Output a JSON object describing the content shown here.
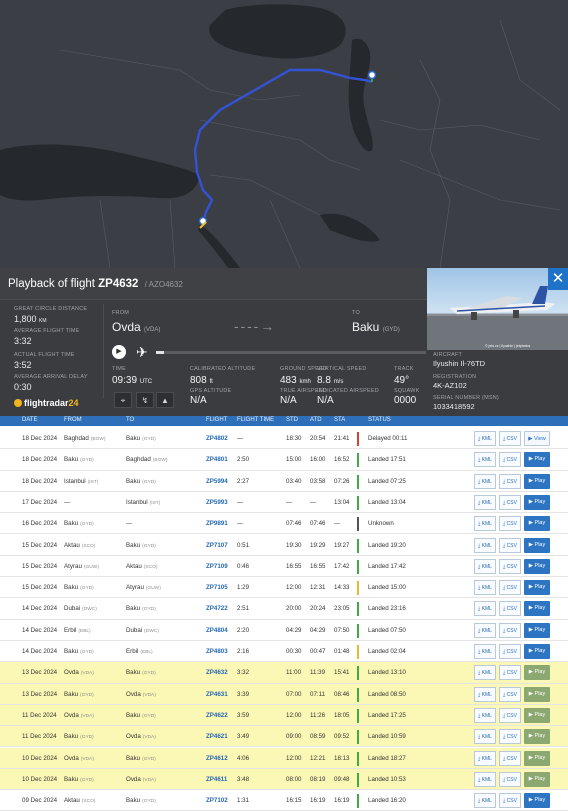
{
  "colors": {
    "route": "#3452d6",
    "panel": "#3a3c40",
    "accent": "#1e73c8",
    "landed": "#40a94a",
    "delayed": "#d9403b",
    "unknown": "#555555",
    "late": "#f2b52f",
    "highlight": "#fbf7b5"
  },
  "panel": {
    "title_prefix": "Playback of flight",
    "flight": "ZP4632",
    "sub": "/ AZO4632",
    "close": "✕",
    "left_stats": [
      {
        "label": "GREAT CIRCLE DISTANCE",
        "value": "1,800",
        "unit": "KM"
      },
      {
        "label": "AVERAGE FLIGHT TIME",
        "value": "3:32"
      },
      {
        "label": "ACTUAL FLIGHT TIME",
        "value": "3:52"
      },
      {
        "label": "AVERAGE ARRIVAL DELAY",
        "value": "0:30"
      }
    ],
    "from_label": "FROM",
    "from_city": "Ovda",
    "from_code": "(VDA)",
    "to_label": "TO",
    "to_city": "Baku",
    "to_code": "(GYD)",
    "arrow": "→",
    "time_label": "TIME",
    "time_value": "09:39",
    "time_unit": "UTC",
    "cal_alt_label": "CALIBRATED ALTITUDE",
    "cal_alt_value": "808",
    "cal_alt_unit": "ft",
    "gps_alt_label": "GPS ALTITUDE",
    "gps_alt_value": "N/A",
    "ground_speed_label": "GROUND SPEED",
    "ground_speed_value": "483",
    "ground_speed_unit": "kmh",
    "true_airspeed_label": "TRUE AIRSPEED",
    "true_airspeed_value": "N/A",
    "vert_speed_label": "VERTICAL SPEED",
    "vert_speed_value": "8.8",
    "vert_speed_unit": "m/s",
    "ind_airspeed_label": "INDICATED AIRSPEED",
    "ind_airspeed_value": "N/A",
    "track_label": "TRACK",
    "track_value": "49°",
    "squawk_label": "SQUAWK",
    "squawk_value": "0000",
    "logo_text": "flightradar",
    "logo_num": "24",
    "photo_credit": "© jets.cz | Ilyushin | jetphotos",
    "aircraft_label": "AIRCRAFT",
    "aircraft_value": "Ilyushin Il-76TD",
    "registration_label": "REGISTRATION",
    "registration_value": "4K-AZ102",
    "serial_label": "SERIAL NUMBER (MSN)",
    "serial_value": "1033418592"
  },
  "table": {
    "headers": [
      "DATE",
      "FROM",
      "TO",
      "FLIGHT",
      "FLIGHT TIME",
      "STD",
      "ATD",
      "STA",
      "STATUS"
    ],
    "kml": "KML",
    "csv": "CSV",
    "play": "▶ Play",
    "view": "▶ View",
    "rows": [
      {
        "date": "18 Dec 2024",
        "from": "Baghdad",
        "from_code": "(BGW)",
        "to": "Baku",
        "to_code": "(GYD)",
        "flight": "ZP4802",
        "ftime": "—",
        "std": "18:30",
        "atd": "20:54",
        "sta": "21:41",
        "status": "Delayed 00:11",
        "bar": "#d9403b",
        "hl": false,
        "btn": "view"
      },
      {
        "date": "18 Dec 2024",
        "from": "Baku",
        "from_code": "(GYD)",
        "to": "Baghdad",
        "to_code": "(BGW)",
        "flight": "ZP4801",
        "ftime": "2:50",
        "std": "15:00",
        "atd": "16:00",
        "sta": "16:52",
        "status": "Landed 17:51",
        "bar": "#40a94a",
        "hl": false,
        "btn": "play"
      },
      {
        "date": "18 Dec 2024",
        "from": "Istanbul",
        "from_code": "(IST)",
        "to": "Baku",
        "to_code": "(GYD)",
        "flight": "ZP5994",
        "ftime": "2:27",
        "std": "03:40",
        "atd": "03:58",
        "sta": "07:26",
        "status": "Landed 07:25",
        "bar": "#40a94a",
        "hl": false,
        "btn": "play"
      },
      {
        "date": "17 Dec 2024",
        "from": "—",
        "from_code": "",
        "to": "Istanbul",
        "to_code": "(IST)",
        "flight": "ZP5993",
        "ftime": "—",
        "std": "—",
        "atd": "—",
        "sta": "13:04",
        "status": "Landed 13:04",
        "bar": "#40a94a",
        "hl": false,
        "btn": "play"
      },
      {
        "date": "16 Dec 2024",
        "from": "Baku",
        "from_code": "(GYD)",
        "to": "—",
        "to_code": "",
        "flight": "ZP9891",
        "ftime": "—",
        "std": "07:46",
        "atd": "07:46",
        "sta": "—",
        "status": "Unknown",
        "bar": "#555555",
        "hl": false,
        "btn": "play"
      },
      {
        "date": "15 Dec 2024",
        "from": "Aktau",
        "from_code": "(SCO)",
        "to": "Baku",
        "to_code": "(GYD)",
        "flight": "ZP7107",
        "ftime": "0:51",
        "std": "19:30",
        "atd": "19:29",
        "sta": "19:27",
        "status": "Landed 19:20",
        "bar": "#40a94a",
        "hl": false,
        "btn": "play"
      },
      {
        "date": "15 Dec 2024",
        "from": "Atyrau",
        "from_code": "(GUW)",
        "to": "Aktau",
        "to_code": "(SCO)",
        "flight": "ZP7109",
        "ftime": "0:46",
        "std": "16:55",
        "atd": "16:55",
        "sta": "17:42",
        "status": "Landed 17:42",
        "bar": "#40a94a",
        "hl": false,
        "btn": "play"
      },
      {
        "date": "15 Dec 2024",
        "from": "Baku",
        "from_code": "(GYD)",
        "to": "Atyrau",
        "to_code": "(GUW)",
        "flight": "ZP7105",
        "ftime": "1:29",
        "std": "12:00",
        "atd": "12:31",
        "sta": "14:33",
        "status": "Landed 15:00",
        "bar": "#f2b52f",
        "hl": false,
        "btn": "play"
      },
      {
        "date": "14 Dec 2024",
        "from": "Dubai",
        "from_code": "(DWC)",
        "to": "Baku",
        "to_code": "(GYD)",
        "flight": "ZP4722",
        "ftime": "2:51",
        "std": "20:00",
        "atd": "20:24",
        "sta": "23:05",
        "status": "Landed 23:16",
        "bar": "#40a94a",
        "hl": false,
        "btn": "play"
      },
      {
        "date": "14 Dec 2024",
        "from": "Erbil",
        "from_code": "(EBL)",
        "to": "Dubai",
        "to_code": "(DWC)",
        "flight": "ZP4804",
        "ftime": "2:20",
        "std": "04:29",
        "atd": "04:29",
        "sta": "07:50",
        "status": "Landed 07:50",
        "bar": "#40a94a",
        "hl": false,
        "btn": "play"
      },
      {
        "date": "14 Dec 2024",
        "from": "Baku",
        "from_code": "(GYD)",
        "to": "Erbil",
        "to_code": "(EBL)",
        "flight": "ZP4803",
        "ftime": "2:16",
        "std": "00:30",
        "atd": "00:47",
        "sta": "01:48",
        "status": "Landed 02:04",
        "bar": "#f2b52f",
        "hl": false,
        "btn": "play"
      },
      {
        "date": "13 Dec 2024",
        "from": "Ovda",
        "from_code": "(VDA)",
        "to": "Baku",
        "to_code": "(GYD)",
        "flight": "ZP4632",
        "ftime": "3:32",
        "std": "11:00",
        "atd": "11:39",
        "sta": "15:41",
        "status": "Landed 13:10",
        "bar": "#40a94a",
        "hl": true,
        "btn": "play"
      },
      {
        "date": "13 Dec 2024",
        "from": "Baku",
        "from_code": "(GYD)",
        "to": "Ovda",
        "to_code": "(VDA)",
        "flight": "ZP4631",
        "ftime": "3:39",
        "std": "07:00",
        "atd": "07:11",
        "sta": "08:46",
        "status": "Landed 08:50",
        "bar": "#40a94a",
        "hl": true,
        "btn": "play"
      },
      {
        "date": "11 Dec 2024",
        "from": "Ovda",
        "from_code": "(VDA)",
        "to": "Baku",
        "to_code": "(GYD)",
        "flight": "ZP4622",
        "ftime": "3:59",
        "std": "12:00",
        "atd": "11:26",
        "sta": "18:05",
        "status": "Landed 17:25",
        "bar": "#40a94a",
        "hl": true,
        "btn": "play"
      },
      {
        "date": "11 Dec 2024",
        "from": "Baku",
        "from_code": "(GYD)",
        "to": "Ovda",
        "to_code": "(VDA)",
        "flight": "ZP4621",
        "ftime": "3:49",
        "std": "09:00",
        "atd": "08:59",
        "sta": "09:52",
        "status": "Landed 10:59",
        "bar": "#40a94a",
        "hl": true,
        "btn": "play"
      },
      {
        "date": "10 Dec 2024",
        "from": "Ovda",
        "from_code": "(VDA)",
        "to": "Baku",
        "to_code": "(GYD)",
        "flight": "ZP4612",
        "ftime": "4:06",
        "std": "12:00",
        "atd": "12:21",
        "sta": "18:13",
        "status": "Landed 18:27",
        "bar": "#40a94a",
        "hl": true,
        "btn": "play"
      },
      {
        "date": "10 Dec 2024",
        "from": "Baku",
        "from_code": "(GYD)",
        "to": "Ovda",
        "to_code": "(VDA)",
        "flight": "ZP4611",
        "ftime": "3:48",
        "std": "08:00",
        "atd": "08:19",
        "sta": "09:48",
        "status": "Landed 10:53",
        "bar": "#40a94a",
        "hl": true,
        "btn": "play"
      },
      {
        "date": "09 Dec 2024",
        "from": "Aktau",
        "from_code": "(SCO)",
        "to": "Baku",
        "to_code": "(GYD)",
        "flight": "ZP7102",
        "ftime": "1:31",
        "std": "16:15",
        "atd": "16:19",
        "sta": "16:19",
        "status": "Landed 16:20",
        "bar": "#40a94a",
        "hl": false,
        "btn": "play"
      }
    ]
  }
}
